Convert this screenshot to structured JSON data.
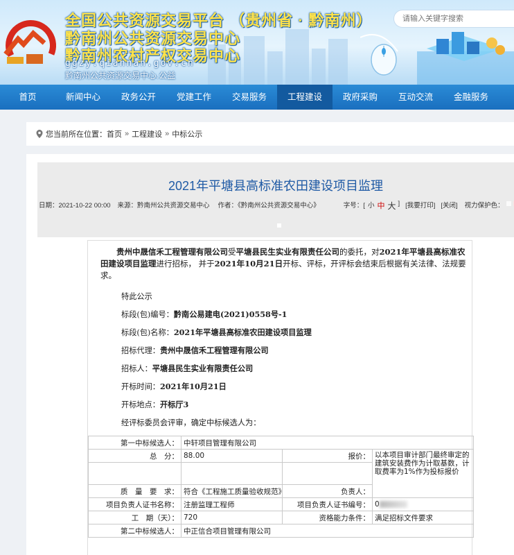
{
  "header": {
    "title_line1": "全国公共资源交易平台 （贵州省 · 黔南州）",
    "title_line2": "黔南州公共资源交易中心",
    "title_line3": "黔南州农村产权交易中心",
    "domain": "ggzy.qiannan.gov.cn",
    "org": "黔南州公共资源交易中心.公益",
    "search_placeholder": "请输入关键字搜索"
  },
  "nav": {
    "items": [
      {
        "label": "首页"
      },
      {
        "label": "新闻中心"
      },
      {
        "label": "政务公开"
      },
      {
        "label": "党建工作"
      },
      {
        "label": "交易服务"
      },
      {
        "label": "工程建设"
      },
      {
        "label": "政府采购"
      },
      {
        "label": "互动交流"
      },
      {
        "label": "金融服务"
      }
    ],
    "active_index": 5
  },
  "breadcrumb": {
    "prefix": "您当前所在位置：",
    "items": [
      "首页",
      "工程建设",
      "中标公示"
    ],
    "separator": "»"
  },
  "article": {
    "title": "2021年平塘县高标准农田建设项目监理",
    "meta": {
      "date": "日期：2021-10-22 00:00",
      "source": "来源：黔南州公共资源交易中心",
      "author": "作者：《黔南州公共资源交易中心》",
      "font_label": "字号：[",
      "font_small": "小",
      "font_mid": "中",
      "font_big": "大",
      "font_close": "]",
      "print": "[我要打印]",
      "close": "[关闭]",
      "eye": "视力保护色："
    },
    "swatch_colors": [
      "#fafafa",
      "#fbe3e3",
      "#d3eaf4",
      "#dde8d6",
      "#e7e3f2",
      "#ececec"
    ],
    "intro": {
      "p1": "贵州中晟信禾工程管理有限公司",
      "p2": "受",
      "p3": "平塘县民生实业有限责任公司",
      "p4": "的委托，对",
      "p5": "2021年平塘县高标准农田建设项目监理",
      "p6": "进行招标， 并于",
      "p7": "2021年10月21日",
      "p8": "开标、评标，开评标会结束后根据有关法律、法规要求。"
    },
    "notice": "特此公示",
    "fields": [
      {
        "label": "标段(包)编号：",
        "value": "黔南公易建电(2021)0558号-1"
      },
      {
        "label": "标段(包)名称：",
        "value": "2021年平塘县高标准农田建设项目监理"
      },
      {
        "label": "招标代理：",
        "value": "贵州中晟信禾工程管理有限公司"
      },
      {
        "label": "招标人：",
        "value": "平塘县民生实业有限责任公司"
      },
      {
        "label": "开标时间：",
        "value": "2021年10月21日"
      },
      {
        "label": "开标地点：",
        "value": "开标厅3"
      }
    ],
    "conclusion": "经评标委员会评审，确定中标候选人为：",
    "table": {
      "first_label": "第一中标候选人：",
      "first_value": "中轩项目管理有限公司",
      "score_label": "总　分：",
      "score_value": "88.00",
      "price_label": "报价：",
      "price_value": "以本项目审计部门最终审定的建筑安装费作为计取基数，计取费率为1%作为投标报价",
      "quality_label": "质　量　要　求：",
      "quality_value": "符合《工程施工质量验收规范》",
      "manager_label": "负责人：",
      "cert_label": "项目负责人证书名称：",
      "cert_value": "注册监理工程师",
      "cert_no_label": "项目负责人证书编号：",
      "cert_no_value": "0",
      "period_label": "工　期（天）：",
      "period_value": "720",
      "qual_label": "资格能力条件：",
      "qual_value": "满足招标文件要求",
      "second_label": "第二中标候选人：",
      "second_value": "中正信合项目管理有限公司"
    }
  }
}
